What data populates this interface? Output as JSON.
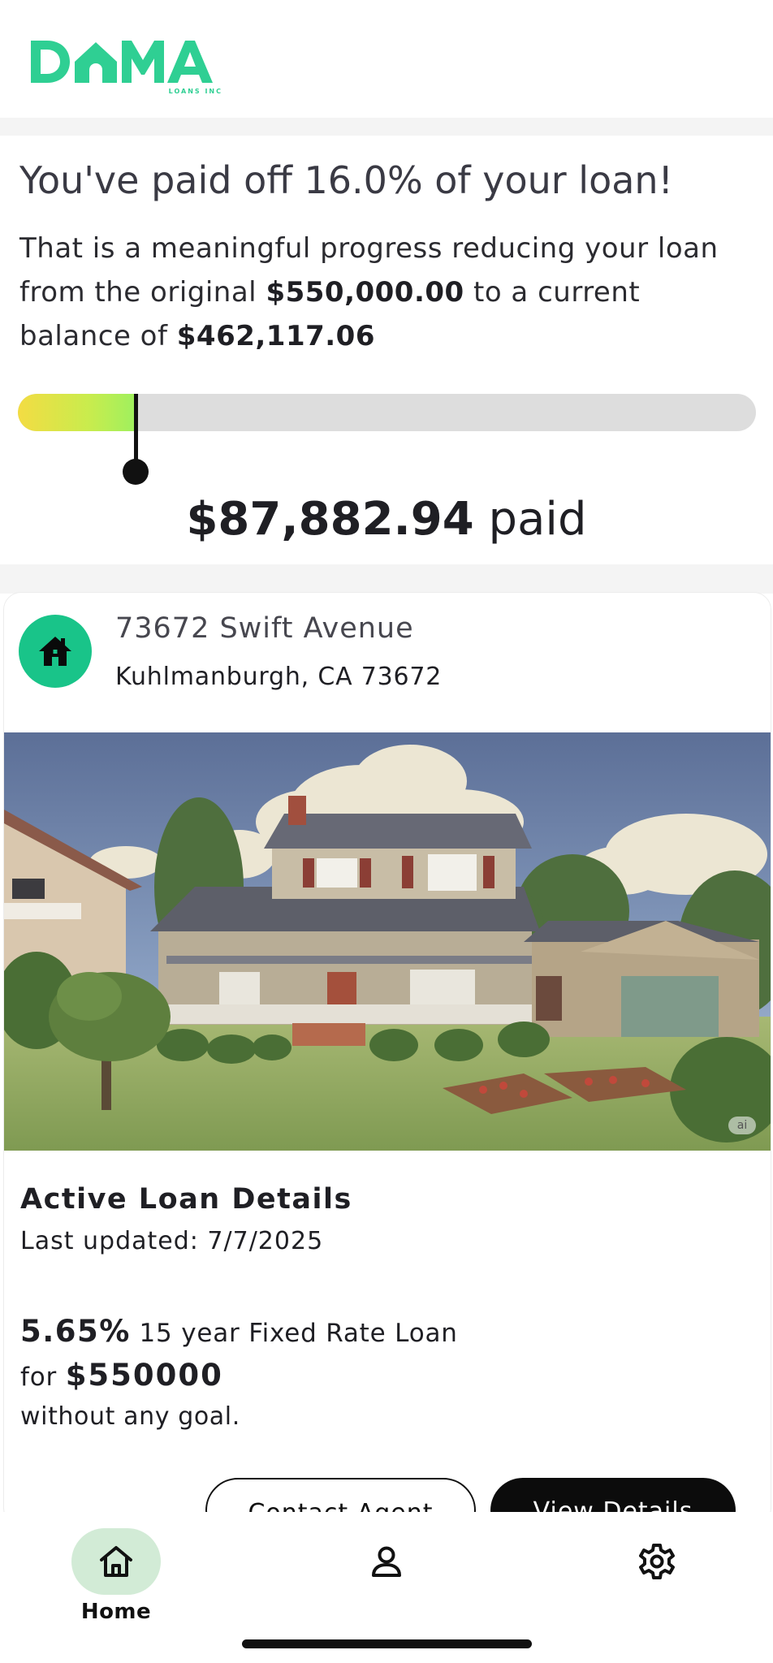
{
  "brand": {
    "name": "DOMA",
    "sub": "LOANS INC",
    "color": "#2fcf93"
  },
  "progress": {
    "headline": "You've paid off 16.0% of your loan!",
    "desc_prefix": "That is a meaningful progress reducing your loan from the original ",
    "original_amount": "$550,000.00",
    "desc_middle": " to a current balance of ",
    "current_balance": "$462,117.06",
    "percent_paid": 16.0,
    "paid_amount": "$87,882.94",
    "paid_suffix": " paid",
    "bar_colors": [
      "#f3dc43",
      "#9ff05e"
    ]
  },
  "property": {
    "icon": "home-icon",
    "address_line1": "73672 Swift Avenue",
    "address_line2": "Kuhlmanburgh, CA 73672",
    "photo_badge": "ai"
  },
  "loan": {
    "title": "Active Loan Details",
    "updated": "Last updated: 7/7/2025",
    "rate": "5.65%",
    "term": " 15 year  Fixed Rate Loan",
    "for_label": "for ",
    "amount": "$550000",
    "goal": "without any goal."
  },
  "actions": {
    "contact": "Contact Agent",
    "view": "View Details"
  },
  "nav": {
    "items": [
      {
        "label": "Home",
        "icon": "home-icon",
        "active": true
      },
      {
        "label": "",
        "icon": "profile-icon",
        "active": false
      },
      {
        "label": "",
        "icon": "settings-gear-icon",
        "active": false
      }
    ],
    "active_color": "#d2ebd6"
  }
}
